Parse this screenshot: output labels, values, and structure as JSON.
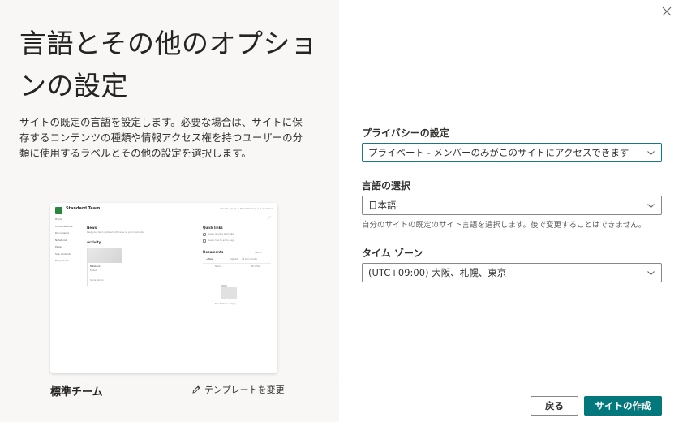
{
  "left": {
    "title": "言語とその他のオプションの設定",
    "description": "サイトの既定の言語を設定します。必要な場合は、サイトに保存するコンテンツの種類や情報アクセス権を持つユーザーの分類に使用するラベルとその他の設定を選択します。",
    "preview": {
      "site_title": "Standard Team",
      "top_right": "Private group   ☆ Not following   ⚇ 1 member",
      "nav": [
        "Home",
        "Conversations",
        "Documents",
        "Notebook",
        "Pages",
        "Site contents",
        "Recycle bin"
      ],
      "news_label": "News",
      "news_text": "Keep your team updated with news on your team site",
      "activity_label": "Activity",
      "card_title": "Notebook",
      "card_meta": "Edited",
      "card_person": "Some Person",
      "quick_links_label": "Quick links",
      "quick_link_1": "Learn about a team site",
      "quick_link_2": "Learn how to add a page",
      "documents_label": "Documents",
      "see_all": "See all",
      "doc_new": "+ New",
      "doc_upload": "Upload",
      "doc_all": "All Documents",
      "doc_name": "Name",
      "doc_modified": "Modified",
      "empty_folder": "This folder is empty"
    },
    "template_name": "標準チーム",
    "change_template": "テンプレートを変更"
  },
  "right": {
    "privacy": {
      "label": "プライバシーの設定",
      "value": "プライベート - メンバーのみがこのサイトにアクセスできます"
    },
    "language": {
      "label": "言語の選択",
      "value": "日本語",
      "hint": "自分のサイトの既定のサイト言語を選択します。後で変更することはできません。"
    },
    "timezone": {
      "label": "タイム ゾーン",
      "value": "(UTC+09:00) 大阪、札幌、東京"
    },
    "buttons": {
      "back": "戻る",
      "create": "サイトの作成"
    }
  },
  "colors": {
    "accent": "#03787c",
    "left_bg": "#f8f7f5",
    "preview_logo": "#2e8540"
  },
  "icons": {
    "close": "close-icon",
    "pencil": "pencil-icon",
    "chevron": "chevron-down-icon"
  }
}
